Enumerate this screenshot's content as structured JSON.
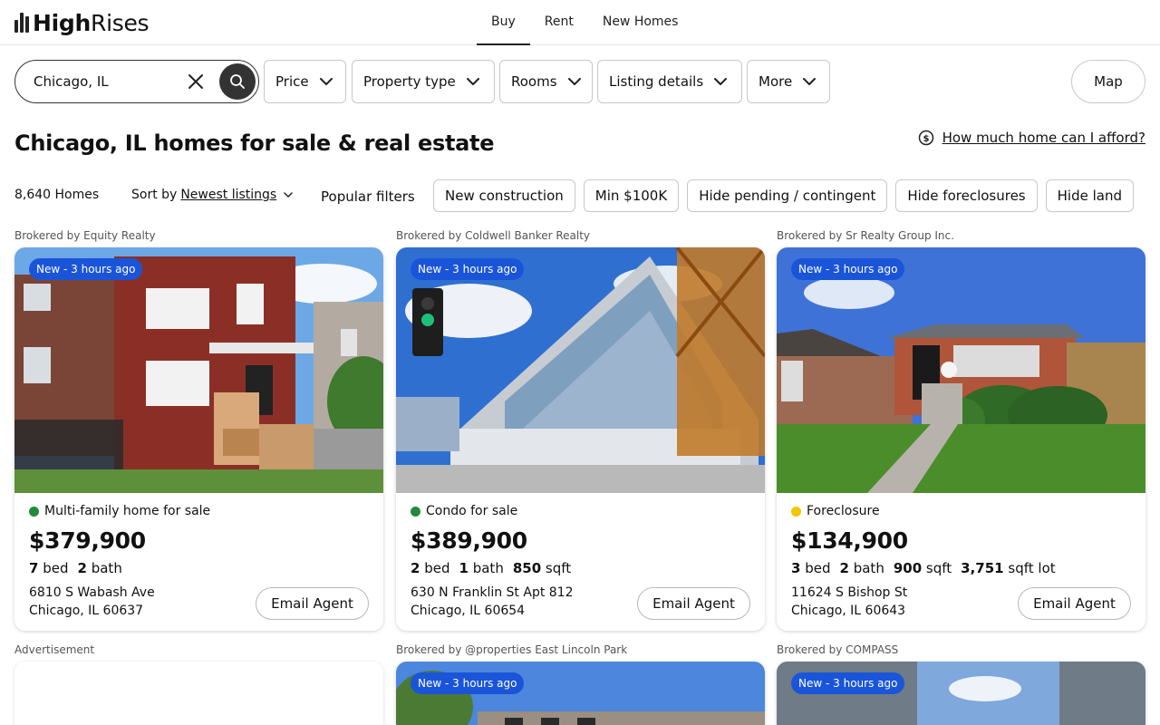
{
  "header": {
    "logo_bold": "High",
    "logo_thin": "Rises",
    "tabs": [
      {
        "label": "Buy",
        "active": true
      },
      {
        "label": "Rent",
        "active": false
      },
      {
        "label": "New Homes",
        "active": false
      }
    ]
  },
  "search": {
    "value": "Chicago, IL",
    "clear_icon": "close-icon",
    "search_icon": "search-icon"
  },
  "filters": {
    "price": "Price",
    "property_type": "Property type",
    "rooms": "Rooms",
    "listing_details": "Listing details",
    "more": "More",
    "map": "Map"
  },
  "page": {
    "title": "Chicago, IL homes for sale & real estate",
    "afford_link": "How much home can I afford?",
    "afford_icon": "dollar-circle-icon"
  },
  "results": {
    "count": "8,640 Homes",
    "sort_label": "Sort by",
    "sort_value": "Newest listings",
    "popular_label": "Popular filters",
    "chips": [
      "New construction",
      "Min $100K",
      "Hide pending / contingent",
      "Hide foreclosures",
      "Hide land"
    ]
  },
  "listings": [
    {
      "brokered": "Brokered by Equity Realty",
      "badge": "New - 3 hours ago",
      "type": "Multi-family home for sale",
      "status_color": "#218a3b",
      "price": "$379,900",
      "beds": "7",
      "beds_unit": "bed",
      "baths": "2",
      "baths_unit": "bath",
      "street": "6810 S Wabash Ave",
      "city": "Chicago, IL 60637",
      "email": "Email Agent"
    },
    {
      "brokered": "Brokered by Coldwell Banker Realty",
      "badge": "New - 3 hours ago",
      "type": "Condo for sale",
      "status_color": "#218a3b",
      "price": "$389,900",
      "beds": "2",
      "beds_unit": "bed",
      "baths": "1",
      "baths_unit": "bath",
      "sqft": "850",
      "sqft_unit": "sqft",
      "street": "630 N Franklin St Apt 812",
      "city": "Chicago, IL 60654",
      "email": "Email Agent"
    },
    {
      "brokered": "Brokered by Sr Realty Group Inc.",
      "badge": "New - 3 hours ago",
      "type": "Foreclosure",
      "status_color": "#f2c700",
      "price": "$134,900",
      "beds": "3",
      "beds_unit": "bed",
      "baths": "2",
      "baths_unit": "bath",
      "sqft": "900",
      "sqft_unit": "sqft",
      "lot": "3,751",
      "lot_unit": "sqft lot",
      "street": "11624 S Bishop St",
      "city": "Chicago, IL 60643",
      "email": "Email Agent"
    }
  ],
  "second_row": {
    "ad_label": "Advertisement",
    "items": [
      {
        "brokered": "Brokered by @properties East Lincoln Park",
        "badge": "New - 3 hours ago"
      },
      {
        "brokered": "Brokered by COMPASS",
        "badge": "New - 3 hours ago"
      }
    ]
  }
}
